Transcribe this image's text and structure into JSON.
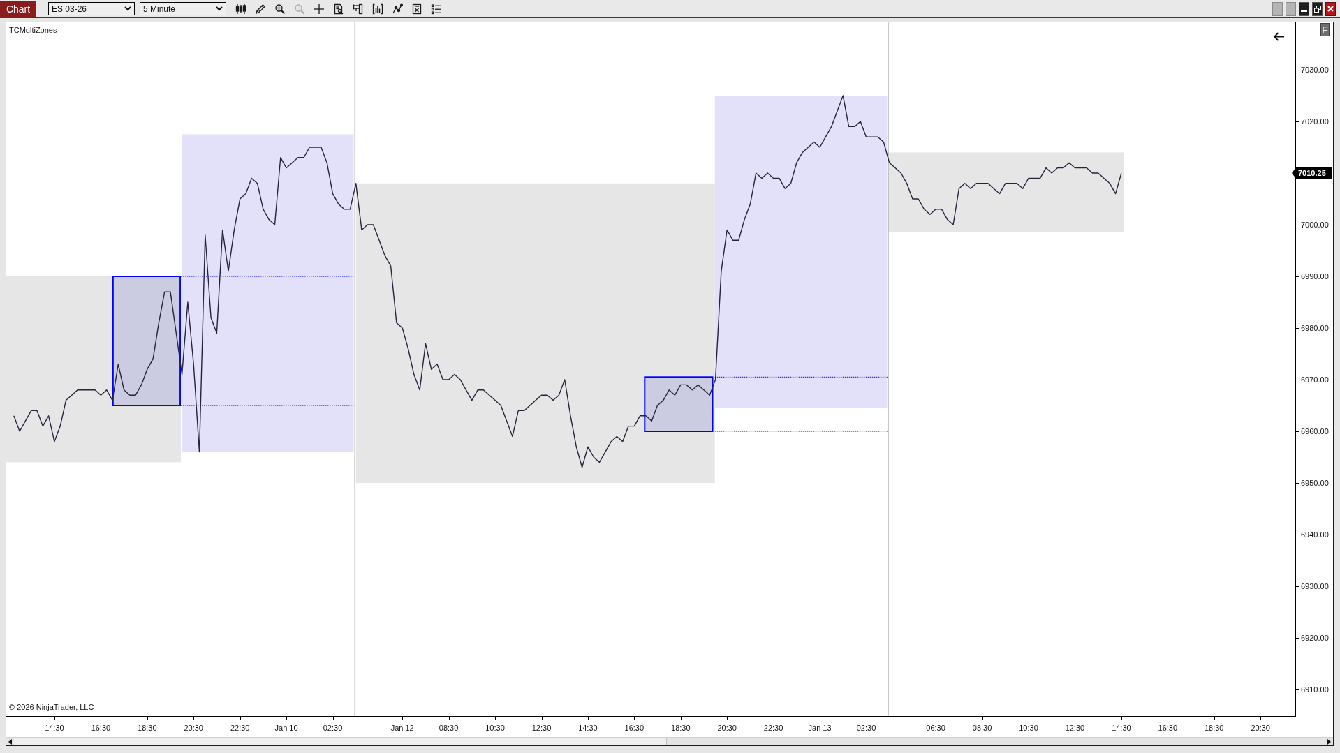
{
  "toolbar": {
    "chart_button": "Chart",
    "instrument": "ES 03-26",
    "interval": "5 Minute",
    "tools": [
      {
        "disabled": false
      },
      {
        "disabled": false
      },
      {
        "disabled": false
      },
      {
        "disabled": true
      },
      {
        "disabled": false
      },
      {
        "disabled": false
      },
      {
        "disabled": false
      },
      {
        "disabled": false
      },
      {
        "disabled": false
      },
      {
        "disabled": false
      },
      {
        "disabled": false
      }
    ]
  },
  "chart": {
    "chart_data": {
      "type": "line",
      "title": "TCMultiZones",
      "categories": [
        null,
        null,
        null,
        null,
        null,
        null,
        null,
        "14:30",
        null,
        null,
        null,
        null,
        null,
        null,
        null,
        "16:30",
        null,
        null,
        null,
        null,
        null,
        null,
        null,
        "18:30",
        null,
        null,
        null,
        null,
        null,
        null,
        null,
        "20:30",
        null,
        null,
        null,
        null,
        null,
        null,
        null,
        "22:30",
        null,
        null,
        null,
        null,
        null,
        null,
        null,
        "Jan 10",
        null,
        null,
        null,
        null,
        null,
        null,
        null,
        "02:30",
        null,
        null,
        null,
        null,
        null,
        null,
        null,
        null,
        null,
        null,
        null,
        "Jan 12",
        null,
        null,
        null,
        null,
        null,
        null,
        null,
        "08:30",
        null,
        null,
        null,
        null,
        null,
        null,
        null,
        "10:30",
        null,
        null,
        null,
        null,
        null,
        null,
        null,
        "12:30",
        null,
        null,
        null,
        null,
        null,
        null,
        null,
        "14:30",
        null,
        null,
        null,
        null,
        null,
        null,
        null,
        "16:30",
        null,
        null,
        null,
        null,
        null,
        null,
        null,
        "18:30",
        null,
        null,
        null,
        null,
        null,
        null,
        null,
        "20:30",
        null,
        null,
        null,
        null,
        null,
        null,
        null,
        "22:30",
        null,
        null,
        null,
        null,
        null,
        null,
        null,
        "Jan 13",
        null,
        null,
        null,
        null,
        null,
        null,
        null,
        "02:30",
        null,
        null,
        null,
        null,
        null,
        null,
        null,
        null,
        null,
        null,
        null,
        "06:30",
        null,
        null,
        null,
        null,
        null,
        null,
        null,
        "08:30",
        null,
        null,
        null,
        null,
        null,
        null,
        null,
        "10:30",
        null,
        null,
        null,
        null,
        null,
        null,
        null,
        "12:30",
        null,
        null,
        null,
        null,
        null,
        null,
        null,
        "14:30",
        null,
        null,
        null,
        null,
        null,
        null,
        null,
        "16:30",
        null,
        null,
        null,
        null,
        null,
        null,
        null,
        "18:30",
        null,
        null,
        null,
        null,
        null,
        null,
        null,
        "20:30",
        null,
        null,
        null,
        null,
        null,
        null
      ],
      "values": [
        6963,
        6960,
        6962,
        6964,
        6964,
        6961,
        6963,
        6958,
        6961,
        6966,
        6967,
        6968,
        6968,
        6968,
        6968,
        6967,
        6968,
        6966,
        6973,
        6968,
        6967,
        6967,
        6969,
        6972,
        6974,
        6981,
        6987,
        6987,
        6979,
        6971,
        6985,
        6973,
        6956,
        6998,
        6982,
        6979,
        6999,
        6991,
        6999,
        7005,
        7006,
        7009,
        7008,
        7003,
        7001,
        7000,
        7013,
        7011,
        7012,
        7013,
        7013,
        7015,
        7015,
        7015,
        7012,
        7006,
        7004,
        7003,
        7003,
        7008,
        6999,
        7000,
        7000,
        6997,
        6994,
        6992,
        6981,
        6980,
        6976,
        6971,
        6968,
        6977,
        6972,
        6973,
        6970,
        6970,
        6971,
        6970,
        6968,
        6966,
        6968,
        6968,
        6967,
        6966,
        6965,
        6962,
        6959,
        6964,
        6964,
        6965,
        6966,
        6967,
        6967,
        6966,
        6967,
        6970,
        6963,
        6957,
        6953,
        6957,
        6955,
        6954,
        6956,
        6958,
        6959,
        6958,
        6961,
        6961,
        6963,
        6963,
        6962,
        6965,
        6966,
        6968,
        6967,
        6969,
        6969,
        6968,
        6969,
        6968,
        6967,
        6970,
        6991,
        6999,
        6997,
        6997,
        7001,
        7004,
        7010,
        7009,
        7010,
        7009,
        7009,
        7007,
        7008,
        7012,
        7014,
        7015,
        7016,
        7015,
        7017,
        7019,
        7022,
        7025,
        7019,
        7019,
        7020,
        7017,
        7017,
        7017,
        7016,
        7012,
        7011,
        7010,
        7008,
        7005,
        7005,
        7003,
        7002,
        7003,
        7003,
        7001,
        7000,
        7007,
        7008,
        7007,
        7008,
        7008,
        7008,
        7007,
        7006,
        7008,
        7008,
        7008,
        7007,
        7009,
        7009,
        7009,
        7011,
        7010,
        7011,
        7011,
        7012,
        7011,
        7011,
        7011,
        7010,
        7010,
        7009,
        7008,
        7006,
        7010,
        null,
        null,
        null,
        null,
        null,
        null,
        null,
        null,
        null,
        null,
        null,
        null,
        null,
        null,
        null,
        null,
        null,
        null,
        null,
        null,
        null,
        null,
        null,
        null,
        null,
        null,
        null,
        null,
        null,
        null
      ],
      "ylim": [
        6904.86,
        7039.19
      ],
      "yticks": [
        {
          "value": 7030,
          "label": "7030.00"
        },
        {
          "value": 7020,
          "label": "7020.00"
        },
        {
          "value": 7000,
          "label": "7000.00"
        },
        {
          "value": 6990,
          "label": "6990.00"
        },
        {
          "value": 6980,
          "label": "6980.00"
        },
        {
          "value": 6970,
          "label": "6970.00"
        },
        {
          "value": 6960,
          "label": "6960.00"
        },
        {
          "value": 6950,
          "label": "6950.00"
        },
        {
          "value": 6940,
          "label": "6940.00"
        },
        {
          "value": 6930,
          "label": "6930.00"
        },
        {
          "value": 6920,
          "label": "6920.00"
        },
        {
          "value": 6910,
          "label": "6910.00"
        }
      ],
      "annotations": [
        "7010.25"
      ]
    },
    "copyright": "© 2026 NinjaTrader, LLC",
    "scale_button": "F"
  }
}
